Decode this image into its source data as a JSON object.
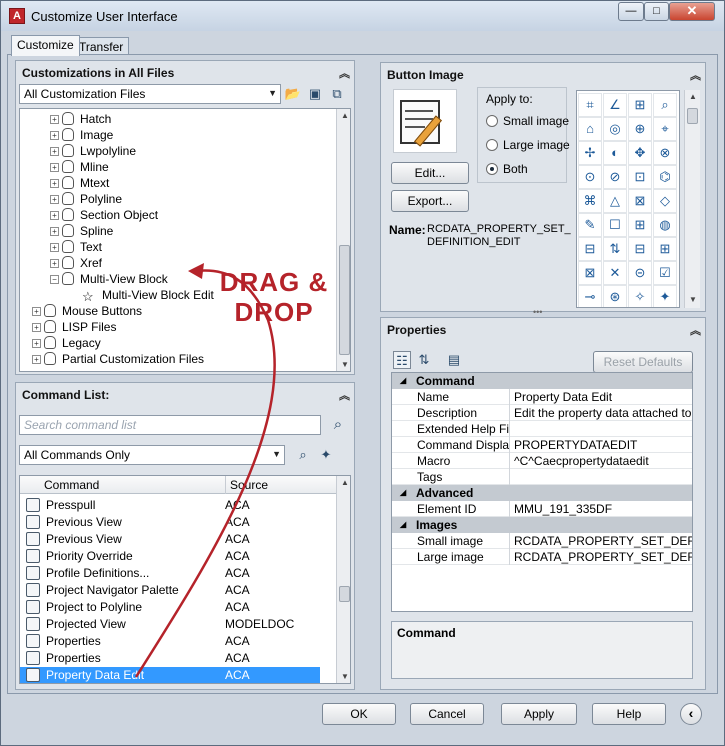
{
  "window": {
    "title": "Customize User Interface",
    "app_icon": "A",
    "close_glyph": "✕",
    "max_glyph": "□",
    "min_glyph": "—"
  },
  "tabs": [
    "Customize",
    "Transfer"
  ],
  "customizations": {
    "header": "Customizations in All Files",
    "filter": "All Customization Files",
    "tree": [
      {
        "label": "Hatch",
        "level": 2
      },
      {
        "label": "Image",
        "level": 2
      },
      {
        "label": "Lwpolyline",
        "level": 2
      },
      {
        "label": "Mline",
        "level": 2
      },
      {
        "label": "Mtext",
        "level": 2
      },
      {
        "label": "Polyline",
        "level": 2
      },
      {
        "label": "Section Object",
        "level": 2
      },
      {
        "label": "Spline",
        "level": 2
      },
      {
        "label": "Text",
        "level": 2
      },
      {
        "label": "Xref",
        "level": 2
      },
      {
        "label": "Multi-View Block",
        "level": 2
      },
      {
        "label": "Multi-View Block Edit",
        "level": 3
      },
      {
        "label": "Mouse Buttons",
        "level": 1
      },
      {
        "label": "LISP Files",
        "level": 1
      },
      {
        "label": "Legacy",
        "level": 1
      },
      {
        "label": "Partial Customization Files",
        "level": 1
      }
    ]
  },
  "overlay": {
    "drag_drop": "DRAG & DROP"
  },
  "command_list": {
    "header": "Command List:",
    "search_placeholder": "Search command list",
    "filter": "All Commands Only",
    "columns": [
      "Command",
      "Source"
    ],
    "rows": [
      {
        "command": "Presspull",
        "source": "ACA"
      },
      {
        "command": "Previous View",
        "source": "ACA"
      },
      {
        "command": "Previous View",
        "source": "ACA"
      },
      {
        "command": "Priority Override",
        "source": "ACA"
      },
      {
        "command": "Profile Definitions...",
        "source": "ACA"
      },
      {
        "command": "Project Navigator Palette",
        "source": "ACA"
      },
      {
        "command": "Project to Polyline",
        "source": "ACA"
      },
      {
        "command": "Projected View",
        "source": "MODELDOC"
      },
      {
        "command": "Properties",
        "source": "ACA"
      },
      {
        "command": "Properties",
        "source": "ACA"
      },
      {
        "command": "Property Data Edit",
        "source": "ACA"
      }
    ]
  },
  "button_image": {
    "header": "Button Image",
    "apply_to": "Apply to:",
    "options": [
      "Small image",
      "Large image",
      "Both"
    ],
    "selected": "Both",
    "edit_label": "Edit...",
    "export_label": "Export...",
    "name_label": "Name:",
    "name_value_1": "RCDATA_PROPERTY_SET_",
    "name_value_2": "DEFINITION_EDIT",
    "grid_glyphs": [
      "⌗",
      "∠",
      "⊞",
      "⌕",
      "⌂",
      "◎",
      "⊕",
      "⌖",
      "✢",
      "◐",
      "✥",
      "⊗",
      "⊙",
      "⊘",
      "⊡",
      "⌬",
      "⌘",
      "△",
      "⊠",
      "◇",
      "✎",
      "☐",
      "⊞",
      "◍",
      "⊟",
      "⇅",
      "⊟",
      "⊞",
      "⊠",
      "✕",
      "⊝",
      "☑",
      "⊸",
      "⊛",
      "✧",
      "✦",
      "◑",
      "◆",
      "⊙",
      "⊛"
    ]
  },
  "properties": {
    "header": "Properties",
    "reset_label": "Reset Defaults",
    "sections": [
      {
        "title": "Command",
        "rows": [
          {
            "name": "Name",
            "value": "Property Data Edit"
          },
          {
            "name": "Description",
            "value": "Edit the property data attached to an o"
          },
          {
            "name": "Extended Help File",
            "value": ""
          },
          {
            "name": "Command Display Na",
            "value": "PROPERTYDATAEDIT"
          },
          {
            "name": "Macro",
            "value": "^C^Caecpropertydataedit"
          },
          {
            "name": "Tags",
            "value": ""
          }
        ]
      },
      {
        "title": "Advanced",
        "rows": [
          {
            "name": "Element ID",
            "value": "MMU_191_335DF"
          }
        ]
      },
      {
        "title": "Images",
        "rows": [
          {
            "name": "Small image",
            "value": "RCDATA_PROPERTY_SET_DEFINIT"
          },
          {
            "name": "Large image",
            "value": "RCDATA_PROPERTY_SET_DEFINIT"
          }
        ]
      }
    ],
    "description_title": "Command"
  },
  "footer": {
    "ok": "OK",
    "cancel": "Cancel",
    "apply": "Apply",
    "help": "Help",
    "collapse_glyph": "‹"
  }
}
